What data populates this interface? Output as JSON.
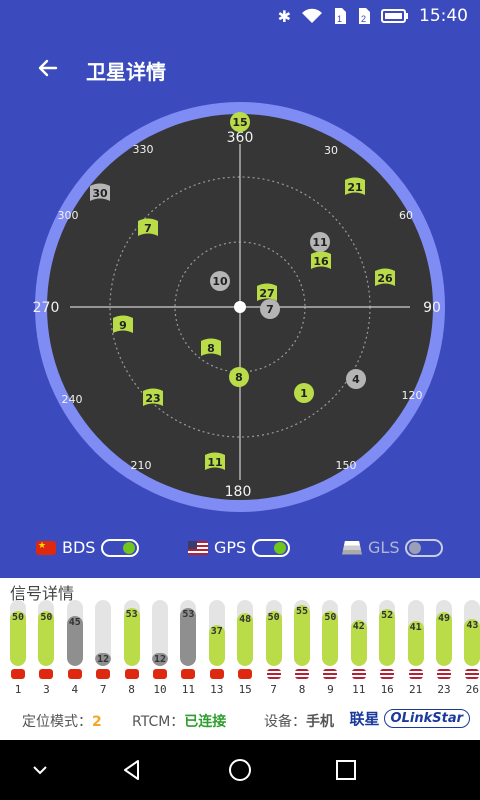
{
  "status": {
    "time": "15:40"
  },
  "header": {
    "title": "卫星详情"
  },
  "radar": {
    "angles": [
      {
        "label": "360"
      },
      {
        "label": "30"
      },
      {
        "label": "60"
      },
      {
        "label": "90"
      },
      {
        "label": "120"
      },
      {
        "label": "150"
      },
      {
        "label": "180"
      },
      {
        "label": "210"
      },
      {
        "label": "240"
      },
      {
        "label": "270"
      },
      {
        "label": "300"
      },
      {
        "label": "330"
      }
    ],
    "satellites": [
      {
        "id": "15",
        "shape": "circle",
        "state": "active"
      },
      {
        "id": "30",
        "shape": "flag",
        "state": "inactive"
      },
      {
        "id": "21",
        "shape": "flag",
        "state": "active"
      },
      {
        "id": "7",
        "shape": "flag",
        "state": "active"
      },
      {
        "id": "11",
        "shape": "circle",
        "state": "inactive"
      },
      {
        "id": "16",
        "shape": "flag",
        "state": "active"
      },
      {
        "id": "26",
        "shape": "flag",
        "state": "active"
      },
      {
        "id": "10",
        "shape": "circle",
        "state": "inactive"
      },
      {
        "id": "27",
        "shape": "flag",
        "state": "active"
      },
      {
        "id": "7",
        "shape": "circle",
        "state": "inactive"
      },
      {
        "id": "9",
        "shape": "flag",
        "state": "active"
      },
      {
        "id": "8",
        "shape": "flag",
        "state": "active"
      },
      {
        "id": "8",
        "shape": "circle",
        "state": "active"
      },
      {
        "id": "4",
        "shape": "circle",
        "state": "inactive"
      },
      {
        "id": "1",
        "shape": "circle",
        "state": "active"
      },
      {
        "id": "23",
        "shape": "flag",
        "state": "active"
      },
      {
        "id": "11",
        "shape": "flag",
        "state": "active"
      }
    ]
  },
  "toggles": {
    "bds": {
      "label": "BDS",
      "on": true
    },
    "gps": {
      "label": "GPS",
      "on": true
    },
    "gls": {
      "label": "GLS",
      "on": false
    }
  },
  "signals": {
    "title": "信号详情",
    "items": [
      {
        "id": "1",
        "value": "50",
        "system": "cn",
        "active": true
      },
      {
        "id": "3",
        "value": "50",
        "system": "cn",
        "active": true
      },
      {
        "id": "4",
        "value": "45",
        "system": "cn",
        "active": false
      },
      {
        "id": "7",
        "value": "12",
        "system": "cn",
        "active": false
      },
      {
        "id": "8",
        "value": "53",
        "system": "cn",
        "active": true
      },
      {
        "id": "10",
        "value": "12",
        "system": "cn",
        "active": false
      },
      {
        "id": "11",
        "value": "53",
        "system": "cn",
        "active": false
      },
      {
        "id": "13",
        "value": "37",
        "system": "cn",
        "active": true
      },
      {
        "id": "15",
        "value": "48",
        "system": "cn",
        "active": true
      },
      {
        "id": "7",
        "value": "50",
        "system": "us",
        "active": true
      },
      {
        "id": "8",
        "value": "55",
        "system": "us",
        "active": true
      },
      {
        "id": "9",
        "value": "50",
        "system": "us",
        "active": true
      },
      {
        "id": "11",
        "value": "42",
        "system": "us",
        "active": true
      },
      {
        "id": "16",
        "value": "52",
        "system": "us",
        "active": true
      },
      {
        "id": "21",
        "value": "41",
        "system": "us",
        "active": true
      },
      {
        "id": "23",
        "value": "49",
        "system": "us",
        "active": true
      },
      {
        "id": "26",
        "value": "43",
        "system": "us",
        "active": true
      }
    ]
  },
  "info": {
    "mode_label": "定位模式：",
    "mode_value": "2",
    "rtcm_label": "RTCM：",
    "rtcm_value": "已连接",
    "device_label": "设备：",
    "device_value": "手机",
    "brand_cn": "联星",
    "brand_en": "OLinkStar"
  },
  "colors": {
    "background": "#3b4bbd",
    "dial_ring": "#7f8cf3",
    "dial_face": "#363636",
    "active": "#b9dc48",
    "inactive": "#b5b5b5",
    "bar_inactive": "#8f8f8f"
  }
}
